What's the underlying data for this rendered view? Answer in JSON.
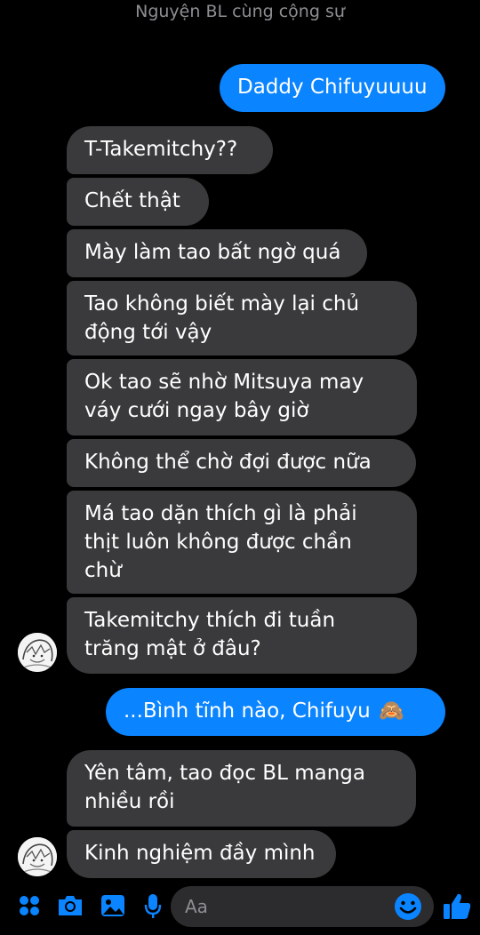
{
  "header": {
    "title": "Nguyện BL cùng cộng sự"
  },
  "messages": [
    {
      "dir": "out",
      "text": "Daddy Chifuyuuuu"
    },
    {
      "dir": "in",
      "text": "T-Takemitchy??"
    },
    {
      "dir": "in",
      "text": "Chết thật"
    },
    {
      "dir": "in",
      "text": "Mày làm tao bất ngờ quá"
    },
    {
      "dir": "in",
      "line1": "Tao không biết mày lại chủ",
      "line2": "động tới vậy"
    },
    {
      "dir": "in",
      "line1": "Ok tao sẽ nhờ Mitsuya may",
      "line2": "váy cưới ngay bây giờ"
    },
    {
      "dir": "in",
      "text": "Không thể chờ đợi được nữa"
    },
    {
      "dir": "in",
      "line1": "Má tao dặn thích gì là phải",
      "line2": "thịt luôn không được chần",
      "line3": "chừ"
    },
    {
      "dir": "in",
      "line1": "Takemitchy thích đi tuần",
      "line2": "trăng mật ở đâu?"
    },
    {
      "dir": "out",
      "text": "...Bình tĩnh nào, Chifuyu",
      "emoji": "🙈"
    },
    {
      "dir": "in",
      "line1": "Yên tâm, tao đọc BL manga",
      "line2": "nhiều rồi"
    },
    {
      "dir": "in",
      "text": "Kinh nghiệm đầy mình"
    }
  ],
  "composer": {
    "placeholder": "Aa",
    "icons": [
      "menu-icon",
      "camera-icon",
      "gallery-icon",
      "microphone-icon",
      "emoji-icon",
      "thumbs-up-icon"
    ],
    "accent_color": "#0a84ff"
  }
}
